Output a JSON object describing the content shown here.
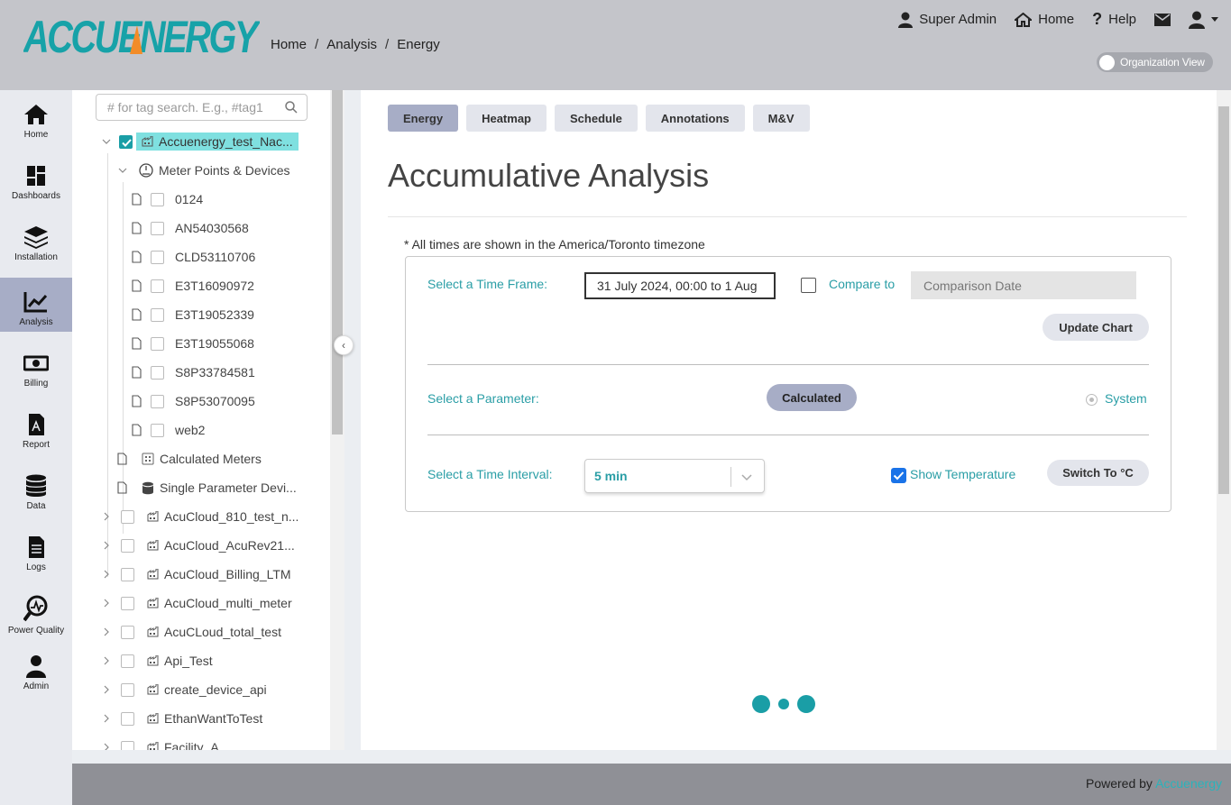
{
  "header": {
    "logo_text": "ACCUENERGY",
    "breadcrumb": [
      "Home",
      "Analysis",
      "Energy"
    ],
    "breadcrumb_sep": "/",
    "nav": {
      "user": "Super Admin",
      "home": "Home",
      "help": "Help"
    },
    "org_toggle_label": "Organization View"
  },
  "sidebar": {
    "items": [
      {
        "label": "Home",
        "icon": "home-icon"
      },
      {
        "label": "Dashboards",
        "icon": "dashboard-icon"
      },
      {
        "label": "Installation",
        "icon": "layers-icon"
      },
      {
        "label": "Analysis",
        "icon": "chart-icon",
        "active": true
      },
      {
        "label": "Billing",
        "icon": "money-icon"
      },
      {
        "label": "Report",
        "icon": "pdf-icon"
      },
      {
        "label": "Data",
        "icon": "database-icon"
      },
      {
        "label": "Logs",
        "icon": "document-icon"
      },
      {
        "label": "Power Quality",
        "icon": "power-quality-icon"
      },
      {
        "label": "Admin",
        "icon": "user-icon"
      }
    ]
  },
  "tree": {
    "search_placeholder": "# for tag search. E.g., #tag1",
    "root": "Accuenergy_test_Nac...",
    "group1": "Meter Points & Devices",
    "devices": [
      "0124",
      "AN54030568",
      "CLD53110706",
      "E3T16090972",
      "E3T19052339",
      "E3T19055068",
      "S8P33784581",
      "S8P53070095",
      "web2"
    ],
    "calculated": "Calculated Meters",
    "single_param": "Single Parameter Devi...",
    "facilities": [
      "AcuCloud_810_test_n...",
      "AcuCloud_AcuRev21...",
      "AcuCloud_Billing_LTM",
      "AcuCloud_multi_meter",
      "AcuCLoud_total_test",
      "Api_Test",
      "create_device_api",
      "EthanWantToTest",
      "Facility_A"
    ]
  },
  "main": {
    "tabs": [
      "Energy",
      "Heatmap",
      "Schedule",
      "Annotations",
      "M&V"
    ],
    "active_tab": "Energy",
    "title": "Accumulative Analysis",
    "tz_note": "* All times are shown in the America/Toronto timezone",
    "timeframe_label": "Select a Time Frame:",
    "timeframe_value": "31 July 2024, 00:00  to  1 Aug",
    "compare_label": "Compare to",
    "compare_placeholder": "Comparison Date",
    "update_button": "Update Chart",
    "parameter_label": "Select a Parameter:",
    "parameter_value": "Calculated",
    "system_label": "System",
    "interval_label": "Select a Time Interval:",
    "interval_value": "5 min",
    "show_temp_label": "Show Temperature",
    "switch_temp_button": "Switch To °C"
  },
  "footer": {
    "powered_by": "Powered by",
    "brand": "Accuenergy"
  },
  "colors": {
    "accent": "#1a9ea6",
    "header_bg": "#c4c5ca",
    "active_bg": "#a7adc6",
    "logo_teal": "#17a2a8",
    "logo_orange": "#f28c28"
  }
}
